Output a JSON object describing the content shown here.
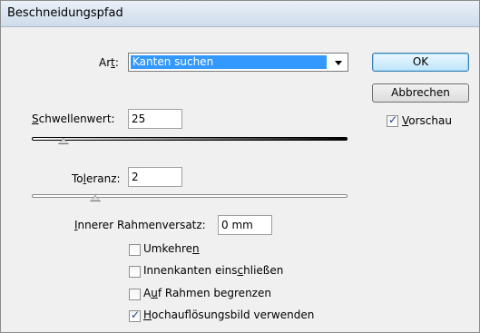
{
  "window": {
    "title": "Beschneidungspfad"
  },
  "art": {
    "label_pre": "Ar",
    "label_u": "t",
    "label_post": ":",
    "value": "Kanten suchen"
  },
  "buttons": {
    "ok": "OK",
    "cancel": "Abbrechen"
  },
  "vorschau": {
    "checked": true,
    "label_u": "V",
    "label_post": "orschau"
  },
  "schwellenwert": {
    "label_u": "S",
    "label_post": "chwellenwert:",
    "value": "25",
    "level": 0.1
  },
  "toleranz": {
    "label_pre": "To",
    "label_u": "l",
    "label_post": "eranz:",
    "value": "2",
    "level": 0.2
  },
  "rahmenversatz": {
    "label_u": "I",
    "label_post": "nnerer Rahmenversatz:",
    "value": "0 mm"
  },
  "options": [
    {
      "pre": "Umkehre",
      "u": "n",
      "post": "",
      "checked": false
    },
    {
      "pre": "Innenkanten eins",
      "u": "c",
      "post": "hließen",
      "checked": false
    },
    {
      "pre": "A",
      "u": "u",
      "post": "f Rahmen begrenzen",
      "checked": false
    },
    {
      "pre": "",
      "u": "H",
      "post": "ochauflösungsbild verwenden",
      "checked": true
    }
  ],
  "checkmark": "✓"
}
